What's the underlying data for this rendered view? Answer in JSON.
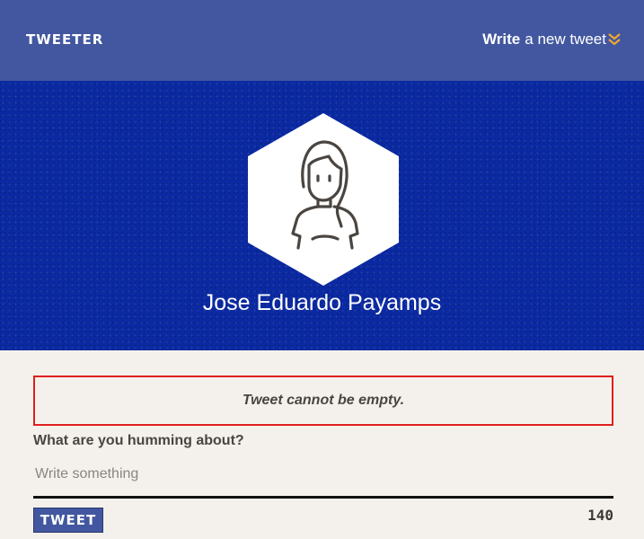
{
  "nav": {
    "brand": "TWEETER",
    "write_bold": "Write",
    "write_rest": "a new tweet",
    "chevron_icon": "double-chevron-down-icon",
    "accent_color": "#f0a830"
  },
  "profile": {
    "avatar_icon": "woman-avatar-icon",
    "first_name": "Jose Eduardo",
    "last_name": "Payamps"
  },
  "compose": {
    "error": "Tweet cannot be empty.",
    "prompt": "What are you humming about?",
    "placeholder": "Write something",
    "value": "",
    "button_label": "TWEET",
    "remaining": "140"
  },
  "colors": {
    "nav": "#4257a0",
    "hero": "#0b2aa2",
    "error_border": "#e01e1e",
    "background": "#f4f1ec"
  }
}
